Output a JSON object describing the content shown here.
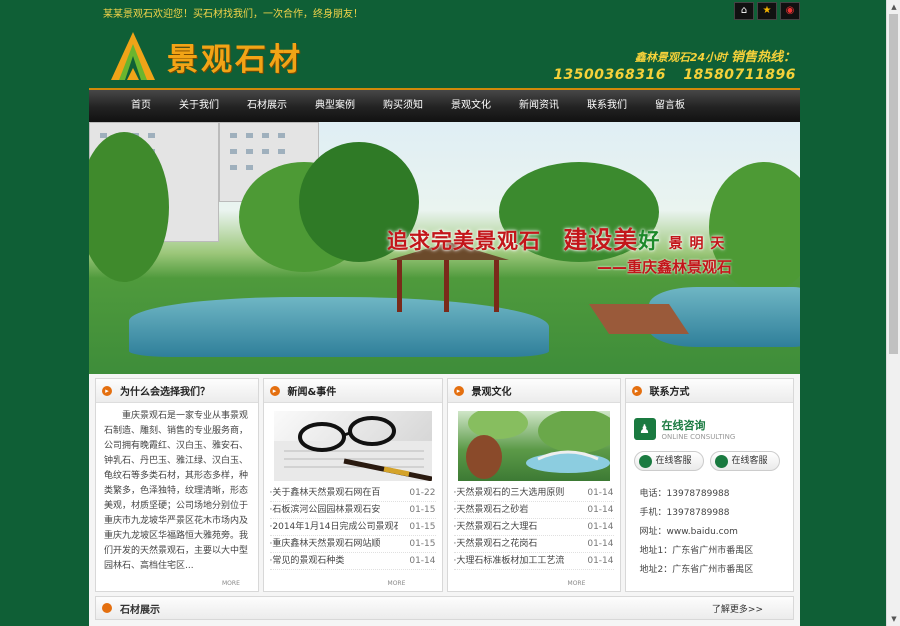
{
  "top": {
    "welcome": "某某景观石欢迎您！买石材找我们，一次合作，终身朋友！",
    "icons": [
      "home-icon",
      "favorite-star-icon",
      "weibo-icon"
    ]
  },
  "header": {
    "logo_text": "景观石材",
    "hotline_title": "鑫林景观石24小时",
    "hotline_label": "销售热线：",
    "phone1": "13500368316",
    "phone2": "18580711896"
  },
  "nav": {
    "items": [
      "首页",
      "关于我们",
      "石材展示",
      "典型案例",
      "购买须知",
      "景观文化",
      "新闻资讯",
      "联系我们",
      "留言板"
    ]
  },
  "banner": {
    "slogan_a": "追求完美景观石",
    "slogan_b": "建设美",
    "slogan_c": "好",
    "slogan_d": "景 明 天",
    "slogan_sub": "——重庆鑫林景观石"
  },
  "why": {
    "title": "为什么会选择我们？",
    "text": "重庆景观石是一家专业从事景观石制造、雕刻、销售的专业服务商，公司拥有晚霞红、汉白玉、雅安石、钟乳石、丹巴玉、雅江绿、汉白玉、龟纹石等多类石材，其形态多样，种类繁多，色泽独特，纹理清晰，形态美观，材质坚硬；公司场地分别位于重庆市九龙坡华严景区花木市场内及重庆九龙坡区华福路恒大雅苑旁。我们开发的天然景观石，主要以大中型园林石、高档住宅区...",
    "more": "MORE"
  },
  "news": {
    "title": "新闻&事件",
    "items": [
      {
        "title": "·关于鑫林天然景观石网在百",
        "date": "01-22"
      },
      {
        "title": "·石板滨河公园园林景观石安",
        "date": "01-15"
      },
      {
        "title": "·2014年1月14日完成公司景观石",
        "date": "01-15"
      },
      {
        "title": "·重庆鑫林天然景观石网站顺",
        "date": "01-15"
      },
      {
        "title": "·常见的景观石种类",
        "date": "01-14"
      }
    ],
    "more": "MORE"
  },
  "culture": {
    "title": "景观文化",
    "items": [
      {
        "title": "·天然景观石的三大选用原则",
        "date": "01-14"
      },
      {
        "title": "·天然景观石之砂岩",
        "date": "01-14"
      },
      {
        "title": "·天然景观石之大理石",
        "date": "01-14"
      },
      {
        "title": "·天然景观石之花岗石",
        "date": "01-14"
      },
      {
        "title": "·大理石标准板材加工工艺流",
        "date": "01-14"
      }
    ],
    "more": "MORE"
  },
  "contact": {
    "title": "联系方式",
    "consult_cn": "在线咨询",
    "consult_en": "ONLINE CONSULTING",
    "qq1": "在线客服",
    "qq2": "在线客服",
    "phone": "电话：13978789988",
    "mobile": "手机：13978789988",
    "site": "网址：www.baidu.com",
    "addr1": "地址1：广东省广州市番禺区",
    "addr2": "地址2：广东省广州市番禺区"
  },
  "showcase": {
    "title": "石材展示",
    "more": "了解更多>>"
  },
  "colors": {
    "background": "#0f5f36",
    "accent_orange": "#f2a416",
    "slogan_red": "#c3161a",
    "brand_green": "#1a7a40"
  }
}
